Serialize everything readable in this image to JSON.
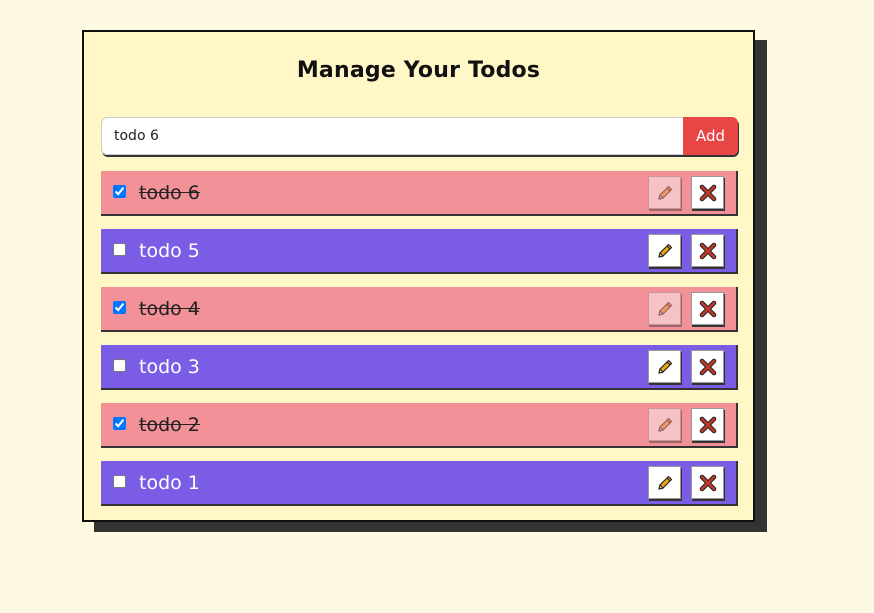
{
  "header": {
    "title": "Manage Your Todos"
  },
  "form": {
    "input_value": "todo 6",
    "add_label": "Add"
  },
  "todos": [
    {
      "text": "todo 6",
      "completed": true
    },
    {
      "text": "todo 5",
      "completed": false
    },
    {
      "text": "todo 4",
      "completed": true
    },
    {
      "text": "todo 3",
      "completed": false
    },
    {
      "text": "todo 2",
      "completed": true
    },
    {
      "text": "todo 1",
      "completed": false
    }
  ],
  "icons": {
    "edit": "pencil-icon",
    "delete": "close-icon"
  },
  "colors": {
    "page_bg": "#fefae2",
    "card_bg": "#fff8c6",
    "done_bg": "#f29198",
    "open_bg": "#7b5ce5",
    "add_button": "#e84545",
    "delete_icon": "#c0392b",
    "edit_icon": "#f3a712"
  }
}
